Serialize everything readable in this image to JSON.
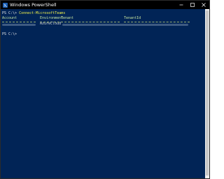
{
  "window": {
    "title": "Windows PowerShell"
  },
  "console": {
    "prompt": "PS C:\\>",
    "command": "Connect-MicrosoftTeams",
    "table": {
      "headers": [
        "Account",
        "Environment",
        "Tenant",
        "TenantId"
      ],
      "row": {
        "environment": "AzureCloud"
      }
    }
  },
  "colors": {
    "background": "#012456",
    "command_text": "#f2f24a",
    "header_text": "#c8e6a0"
  }
}
